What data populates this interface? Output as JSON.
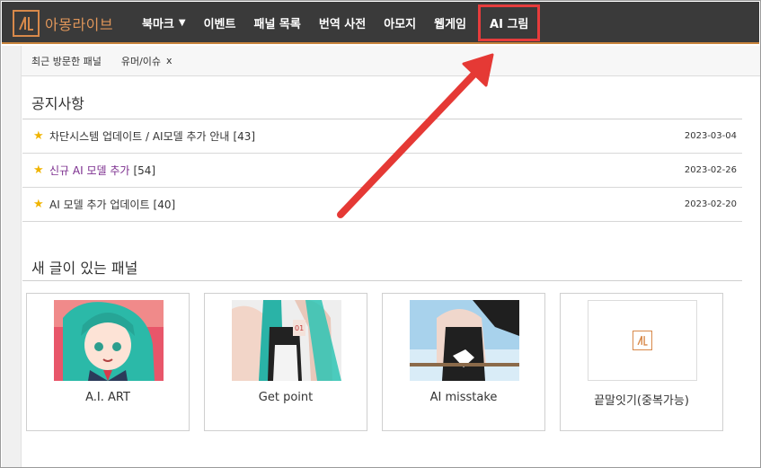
{
  "brand": {
    "name": "아몽라이브"
  },
  "nav": {
    "items": [
      {
        "label": "북마크",
        "caret": "▼"
      },
      {
        "label": "이벤트"
      },
      {
        "label": "패널 목록"
      },
      {
        "label": "번역 사전"
      },
      {
        "label": "아모지"
      },
      {
        "label": "웹게임"
      },
      {
        "label": "AI 그림"
      }
    ]
  },
  "recent": {
    "label": "최근 방문한 패널",
    "tags": [
      {
        "label": "유머/이슈",
        "close": "x"
      }
    ]
  },
  "notices": {
    "title": "공지사항",
    "items": [
      {
        "title": "차단시스템 업데이트 / AI모델 추가 안내",
        "count": "[43]",
        "date": "2023-03-04"
      },
      {
        "title": "신규 AI 모델 추가",
        "count": "[54]",
        "date": "2023-02-26"
      },
      {
        "title": "AI 모델 추가 업데이트",
        "count": "[40]",
        "date": "2023-02-20"
      }
    ]
  },
  "panels": {
    "title": "새 글이 있는 패널",
    "items": [
      {
        "label": "A.I. ART"
      },
      {
        "label": "Get point"
      },
      {
        "label": "AI misstake"
      },
      {
        "label": "끝말잇기(중복가능)"
      }
    ]
  },
  "colors": {
    "nav_bg": "#3a3a3a",
    "brand_orange": "#d8894a",
    "highlight_red": "#e63c3c",
    "star": "#f0b400",
    "purple_link": "#7b2d8e"
  }
}
